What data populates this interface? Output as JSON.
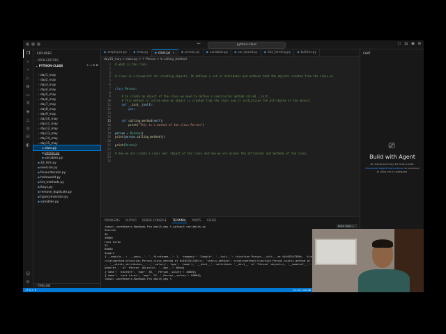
{
  "titlebar": {
    "search": "python-class"
  },
  "sidebar": {
    "title": "EXPLORER",
    "open_editors": "OPEN EDITORS",
    "folder": "PYTHON-CLASS",
    "timeline": "TIMELINE",
    "items": [
      {
        "label": "day1_may",
        "kind": "folder"
      },
      {
        "label": "day2_may",
        "kind": "folder"
      },
      {
        "label": "day3_may",
        "kind": "folder"
      },
      {
        "label": "day4_may",
        "kind": "folder"
      },
      {
        "label": "day5_may",
        "kind": "folder"
      },
      {
        "label": "day6_may",
        "kind": "folder"
      },
      {
        "label": "day7_may",
        "kind": "folder"
      },
      {
        "label": "day8_may",
        "kind": "folder"
      },
      {
        "label": "day9_may",
        "kind": "folder"
      },
      {
        "label": "day10_may",
        "kind": "folder"
      },
      {
        "label": "day11_may",
        "kind": "folder"
      },
      {
        "label": "day12_may",
        "kind": "folder"
      },
      {
        "label": "day13_may",
        "kind": "folder"
      },
      {
        "label": "day14_may",
        "kind": "folder"
      },
      {
        "label": "day15_may",
        "kind": "folder-open"
      },
      {
        "label": "class.py",
        "kind": "file-sel"
      },
      {
        "label": "person.py",
        "kind": "file-ul"
      },
      {
        "label": "variables.py",
        "kind": "file"
      },
      {
        "label": "2d_lists.py",
        "kind": "file-root"
      },
      {
        "label": "exercise.py",
        "kind": "file-root"
      },
      {
        "label": "favouritecolor.py",
        "kind": "file-root"
      },
      {
        "label": "helloworld.py",
        "kind": "file-root"
      },
      {
        "label": "list_methods.py",
        "kind": "file-root"
      },
      {
        "label": "lkeys.py",
        "kind": "file-root"
      },
      {
        "label": "remove_duplicate.py",
        "kind": "file-root"
      },
      {
        "label": "typeconversion.py",
        "kind": "file-root"
      },
      {
        "label": "variables.py",
        "kind": "file-root"
      }
    ]
  },
  "tabs": [
    {
      "label": "employee.py",
      "active": false
    },
    {
      "label": "emp.py",
      "active": false
    },
    {
      "label": "class.py",
      "active": true
    },
    {
      "label": "person.py",
      "active": false
    },
    {
      "label": "variables.py",
      "active": false
    },
    {
      "label": "car_brand.py",
      "active": false
    },
    {
      "label": "dict_forming.py",
      "active": false
    },
    {
      "label": "builtins.py",
      "active": false
    }
  ],
  "breadcrumb": "day15_may > class.py > ⚘ Person > ⚙ calling_method",
  "code": [
    {
      "n": "1",
      "parts": [
        [
          "cm",
          "# what is the class"
        ]
      ]
    },
    {
      "n": "2",
      "parts": []
    },
    {
      "n": "3",
      "parts": []
    },
    {
      "n": "4",
      "parts": [
        [
          "cm",
          "# class is a blueprint for creating objects. It defines a set of attributes and methods that the objects created from the class wi"
        ]
      ]
    },
    {
      "n": "5",
      "parts": []
    },
    {
      "n": "6",
      "parts": []
    },
    {
      "n": "7",
      "parts": [
        [
          "kw",
          "class "
        ],
        [
          "cls",
          "Person"
        ],
        [
          "pl",
          ":"
        ]
      ]
    },
    {
      "n": "8",
      "parts": []
    },
    {
      "n": "9",
      "parts": [
        [
          "cm",
          "    # to create an object of the class we need to define a constructor method called __init__"
        ]
      ]
    },
    {
      "n": "10",
      "parts": [
        [
          "cm",
          "    # This method is called when an object is created from the class and it initializes the attributes of the object."
        ]
      ]
    },
    {
      "n": "11",
      "parts": [
        [
          "pl",
          "    "
        ],
        [
          "kw",
          "def "
        ],
        [
          "fn",
          "__init__"
        ],
        [
          "pl",
          "("
        ],
        [
          "sf",
          "self"
        ],
        [
          "pl",
          "):"
        ]
      ]
    },
    {
      "n": "12",
      "parts": [
        [
          "kw",
          "        pass"
        ]
      ]
    },
    {
      "n": "13",
      "parts": []
    },
    {
      "n": "14",
      "parts": []
    },
    {
      "n": "15",
      "parts": [
        [
          "pl",
          "    "
        ],
        [
          "kw",
          "def "
        ],
        [
          "fn",
          "calling_method"
        ],
        [
          "pl",
          "("
        ],
        [
          "sf",
          "self"
        ],
        [
          "pl",
          "):"
        ]
      ]
    },
    {
      "n": "16",
      "parts": [
        [
          "fn",
          "        print"
        ],
        [
          "pl",
          "("
        ],
        [
          "st",
          "\"This is a method of the class Person\""
        ],
        [
          "pl",
          ")"
        ]
      ]
    },
    {
      "n": "17",
      "parts": []
    },
    {
      "n": "18",
      "parts": [
        [
          "sf",
          "person"
        ],
        [
          "pl",
          " = "
        ],
        [
          "cls",
          "Person"
        ],
        [
          "pl",
          "()"
        ]
      ]
    },
    {
      "n": "19",
      "parts": [
        [
          "fn",
          "print"
        ],
        [
          "pl",
          "("
        ],
        [
          "sf",
          "person"
        ],
        [
          "pl",
          "."
        ],
        [
          "fn",
          "calling_method"
        ],
        [
          "pl",
          "())"
        ]
      ]
    },
    {
      "n": "20",
      "parts": []
    },
    {
      "n": "21",
      "parts": [
        [
          "fn",
          "print"
        ],
        [
          "pl",
          "("
        ],
        [
          "cls",
          "Person"
        ],
        [
          "pl",
          ")"
        ]
      ]
    },
    {
      "n": "22",
      "parts": []
    },
    {
      "n": "23",
      "parts": [
        [
          "cm",
          "# how we are create a class and  object of the class and how we are access the attributes and methods of the class."
        ]
      ]
    },
    {
      "n": "24",
      "parts": []
    },
    {
      "n": "25",
      "parts": []
    }
  ],
  "panel": {
    "tabs": [
      "PROBLEMS",
      "OUTPUT",
      "DEBUG CONSOLE",
      "TERMINAL",
      "PORTS",
      "AZURE"
    ],
    "active_tab": "TERMINAL",
    "terminal_lines": [
      "(base) user@Users-MacBook-Pro day15_may % python3 variables.py",
      "Sharath",
      "30",
      "30000",
      "ravi kiran",
      "22",
      "60000",
      "Google",
      "{'__module__': '__main__', '__firstname__': 1, 'company': 'Google', '__init__': <function Person.__init__ at 0x1057a7380>, 'class_m",
      "<classmethod(<function Person.class_method at 0x1057a7420>)>, 'static_method': <staticmethod(<function Person.static_method at 0x1",
      "_, '__static_attributes__': ('_salary', 'age', 'name'), '__dict__': <attribute '__dict__' of 'Person' objects>, '__weakref__': <attri",
      "weakref__' of 'Person' objects>, '__doc__': None}",
      "{'name': 'sharath', 'age': 30, '_Person__salary': 30000}",
      "{'name': 'ravi kiran', 'age': 22, '_Person__salary': 60000}",
      "(base) user@Users-MacBook-Pro day15_may % "
    ],
    "sessions": [
      "bash day1...",
      "Python Ru..."
    ]
  },
  "chat": {
    "header": "CHAT",
    "title": "Build with Agent",
    "line1": "AI responses may be inaccurate.",
    "link": "Generate Agent Instructions",
    "line2": "to onboard",
    "line3": "AI onto your codebase."
  },
  "statusbar": {
    "left": "⎇ 0 ⚠ 0",
    "right": "Ln 15, Col 28"
  }
}
